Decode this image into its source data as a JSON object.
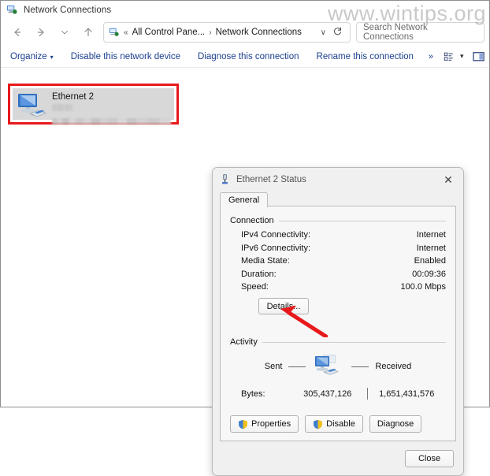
{
  "window": {
    "title": "Network Connections",
    "title_icon": "network-connections-icon"
  },
  "nav": {
    "back": "←",
    "forward": "→",
    "recent": "∨",
    "up": "↑",
    "address": {
      "icon": "control-panel-icon",
      "prefix": "«",
      "crumb1": "All Control Pane...",
      "separator": "›",
      "crumb2": "Network Connections",
      "dropdown": "∨",
      "refresh": "↻"
    },
    "search": {
      "placeholder": "Search Network Connections",
      "value": ""
    }
  },
  "command_bar": {
    "organize": "Organize",
    "organize_caret": "▾",
    "disable_device": "Disable this network device",
    "diagnose_connection": "Diagnose this connection",
    "rename_connection": "Rename this connection",
    "overflow": "»",
    "view_caret": "▾"
  },
  "connection_list": {
    "items": [
      {
        "name": "Ethernet 2",
        "icon": "network-adapter-icon",
        "detail_blurred": true,
        "selected": true,
        "highlight_color": "#e8191b"
      }
    ]
  },
  "dialog": {
    "title": "Ethernet 2 Status",
    "title_icon": "network-status-icon",
    "close_icon": "✕",
    "tabs": [
      {
        "label": "General",
        "active": true
      }
    ],
    "connection": {
      "group_title": "Connection",
      "rows": [
        {
          "label": "IPv4 Connectivity:",
          "value": "Internet"
        },
        {
          "label": "IPv6 Connectivity:",
          "value": "Internet"
        },
        {
          "label": "Media State:",
          "value": "Enabled"
        },
        {
          "label": "Duration:",
          "value": "00:09:36"
        },
        {
          "label": "Speed:",
          "value": "100.0 Mbps"
        }
      ],
      "details_button": "Details..."
    },
    "activity": {
      "group_title": "Activity",
      "sent_label": "Sent",
      "received_label": "Received",
      "graphic_icon": "activity-computers-icon",
      "bytes_label": "Bytes:",
      "bytes_sent": "305,437,126",
      "bytes_received": "1,651,431,576"
    },
    "actions": [
      {
        "label": "Properties",
        "icon": "uac-shield-icon"
      },
      {
        "label": "Disable",
        "icon": "uac-shield-icon"
      },
      {
        "label": "Diagnose",
        "icon": null
      }
    ],
    "close_button": "Close"
  },
  "annotations": {
    "arrow": {
      "name": "red-arrow",
      "color": "#e8191b",
      "points_at": "Details..."
    }
  },
  "watermark": {
    "text": "www.wintips.org"
  }
}
